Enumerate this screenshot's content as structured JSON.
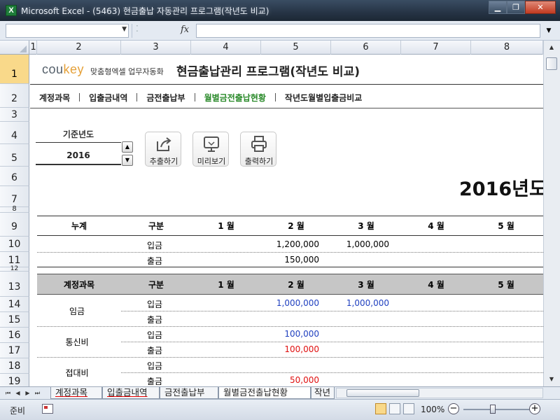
{
  "window": {
    "title": "Microsoft Excel - (5463) 현금출납 자동관리 프로그램(작년도 비교)",
    "app_icon": "X",
    "minimize": "▁",
    "restore": "❐",
    "close": "✕"
  },
  "formula_bar": {
    "fx": "fx",
    "dots": "⁚"
  },
  "columns": [
    "1",
    "2",
    "3",
    "4",
    "5",
    "6",
    "7",
    "8"
  ],
  "rows": [
    "1",
    "2",
    "3",
    "4",
    "5",
    "6",
    "7",
    "8",
    "9",
    "10",
    "11",
    "12",
    "13",
    "14",
    "15",
    "16",
    "17",
    "18",
    "19"
  ],
  "brand": {
    "name_part1": "cou",
    "name_part2": "key",
    "tagline": "맞춤형엑셀 업무자동화"
  },
  "title": "현금출납관리 프로그램(작년도 비교)",
  "nav": [
    "계정과목",
    "입출금내역",
    "금전출납부",
    "월별금전출납현황",
    "작년도월별입출금비교"
  ],
  "year_select": {
    "label": "기준년도",
    "value": "2016"
  },
  "action_buttons": {
    "export": "추출하기",
    "preview": "미리보기",
    "print": "출력하기"
  },
  "report_year": "2016년도",
  "summary": {
    "headers": [
      "누계",
      "구분",
      "1 월",
      "2 월",
      "3 월",
      "4 월",
      "5 월"
    ],
    "rows": [
      {
        "type": "입금",
        "m1": "",
        "m2": "1,200,000",
        "m3": "1,000,000",
        "m4": "",
        "m5": ""
      },
      {
        "type": "출금",
        "m1": "",
        "m2": "150,000",
        "m3": "",
        "m4": "",
        "m5": ""
      }
    ]
  },
  "accounts": {
    "headers": [
      "계정과목",
      "구분",
      "1 월",
      "2 월",
      "3 월",
      "4 월",
      "5 월"
    ],
    "groups": [
      {
        "name": "임금",
        "in": {
          "m2": "1,000,000",
          "m3": "1,000,000"
        },
        "out": {
          "m2": "",
          "m3": ""
        }
      },
      {
        "name": "통신비",
        "in": {
          "m2": "100,000",
          "m3": ""
        },
        "out": {
          "m2": "100,000",
          "m3": ""
        }
      },
      {
        "name": "접대비",
        "in": {
          "m2": "",
          "m3": ""
        },
        "out": {
          "m2": "50,000",
          "m3": ""
        }
      }
    ],
    "in_label": "입금",
    "out_label": "출금"
  },
  "sheet_tabs": [
    "계정과목",
    "입출금내역",
    "금전출납부",
    "월별금전출납현황",
    "작년"
  ],
  "status": {
    "ready": "준비",
    "zoom": "100%",
    "zoom_out": "−",
    "zoom_in": "+"
  },
  "colors": {
    "active_nav": "#2a8a2a",
    "income_blue": "#1f3fbf",
    "expense_red": "#e01010",
    "header_gray": "#c6c6c6",
    "brand_orange": "#e5a13a"
  }
}
